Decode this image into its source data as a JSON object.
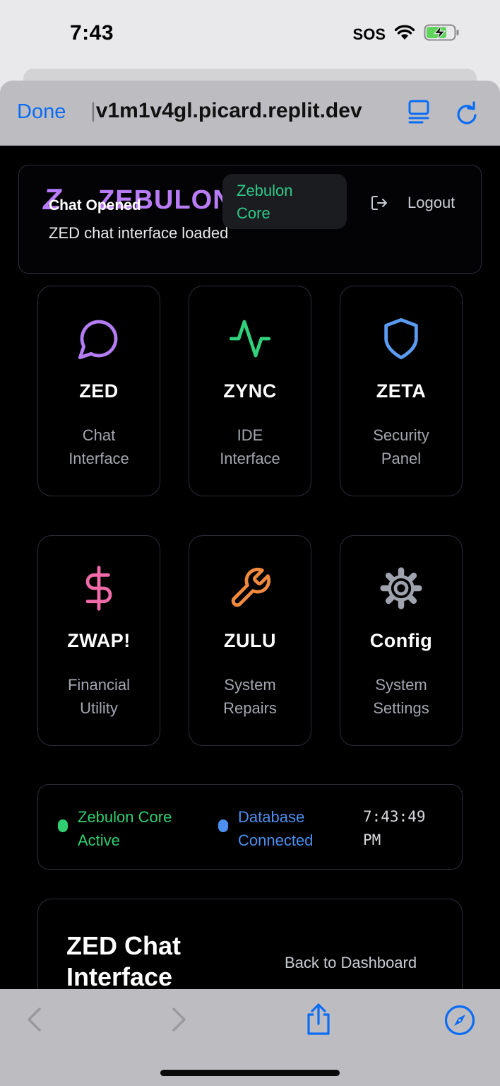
{
  "status_bar": {
    "time": "7:43",
    "carrier": "SOS"
  },
  "browser": {
    "done_label": "Done",
    "url": "v1m1v4gl.picard.replit.dev",
    "cursor": "|"
  },
  "header": {
    "logo_mark": "Z",
    "brand": "ZEBULON",
    "toast_title": "Chat Opened",
    "toast_description": "ZED chat interface loaded",
    "core_badge_line1": "Zebulon",
    "core_badge_line2": "Core",
    "logout_label": "Logout"
  },
  "modules": [
    {
      "name": "ZED",
      "desc1": "Chat",
      "desc2": "Interface",
      "icon": "chat-bubble-icon",
      "color": "#b47cf5"
    },
    {
      "name": "ZYNC",
      "desc1": "IDE",
      "desc2": "Interface",
      "icon": "activity-icon",
      "color": "#31d07b"
    },
    {
      "name": "ZETA",
      "desc1": "Security",
      "desc2": "Panel",
      "icon": "shield-icon",
      "color": "#5b9cf2"
    },
    {
      "name": "ZWAP!",
      "desc1": "Financial",
      "desc2": "Utility",
      "icon": "dollar-icon",
      "color": "#f06ba8"
    },
    {
      "name": "ZULU",
      "desc1": "System",
      "desc2": "Repairs",
      "icon": "wrench-icon",
      "color": "#f28a3d"
    },
    {
      "name": "Config",
      "desc1": "System",
      "desc2": "Settings",
      "icon": "gear-icon",
      "color": "#9ea3ad"
    }
  ],
  "system_status": {
    "core_line1": "Zebulon Core",
    "core_line2": "Active",
    "core_color": "#2fce6f",
    "db_line1": "Database",
    "db_line2": "Connected",
    "db_color": "#4d8ff0",
    "clock_line1": "7:43:49",
    "clock_line2": "PM"
  },
  "chat_panel": {
    "title": "ZED Chat Interface",
    "back_label": "Back to Dashboard"
  },
  "colors": {
    "accent_blue": "#0a6cf5",
    "card_border": "#2b2e3a"
  }
}
